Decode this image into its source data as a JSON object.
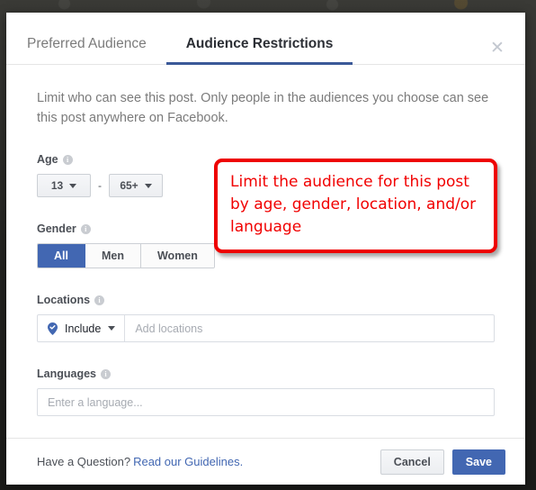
{
  "dialog": {
    "tabs": [
      {
        "label": "Preferred Audience",
        "active": false
      },
      {
        "label": "Audience Restrictions",
        "active": true
      }
    ],
    "close_icon": "close-icon",
    "intro": "Limit who can see this post. Only people in the audiences you choose can see this post anywhere on Facebook.",
    "age": {
      "label": "Age",
      "info_glyph": "i",
      "min_value": "13",
      "max_value": "65+",
      "separator": "-"
    },
    "gender": {
      "label": "Gender",
      "info_glyph": "i",
      "options": [
        "All",
        "Men",
        "Women"
      ],
      "selected": "All"
    },
    "locations": {
      "label": "Locations",
      "info_glyph": "i",
      "mode_label": "Include",
      "mode_icon": "map-pin-check-icon",
      "placeholder": "Add locations",
      "value": ""
    },
    "languages": {
      "label": "Languages",
      "info_glyph": "i",
      "placeholder": "Enter a language...",
      "value": ""
    },
    "footer": {
      "question_text": "Have a Question?",
      "link_text": "Read our Guidelines.",
      "cancel_label": "Cancel",
      "save_label": "Save"
    }
  },
  "annotation": {
    "text": "Limit the audience for this post by age, gender, location, and/or language",
    "border_color": "#ee0000",
    "text_color": "#f10000"
  },
  "colors": {
    "facebook_blue": "#4267b2",
    "tab_underline": "#3b5998",
    "link_blue": "#4267b2",
    "muted_text": "#7b7b7b",
    "label_text": "#4b4f56"
  }
}
